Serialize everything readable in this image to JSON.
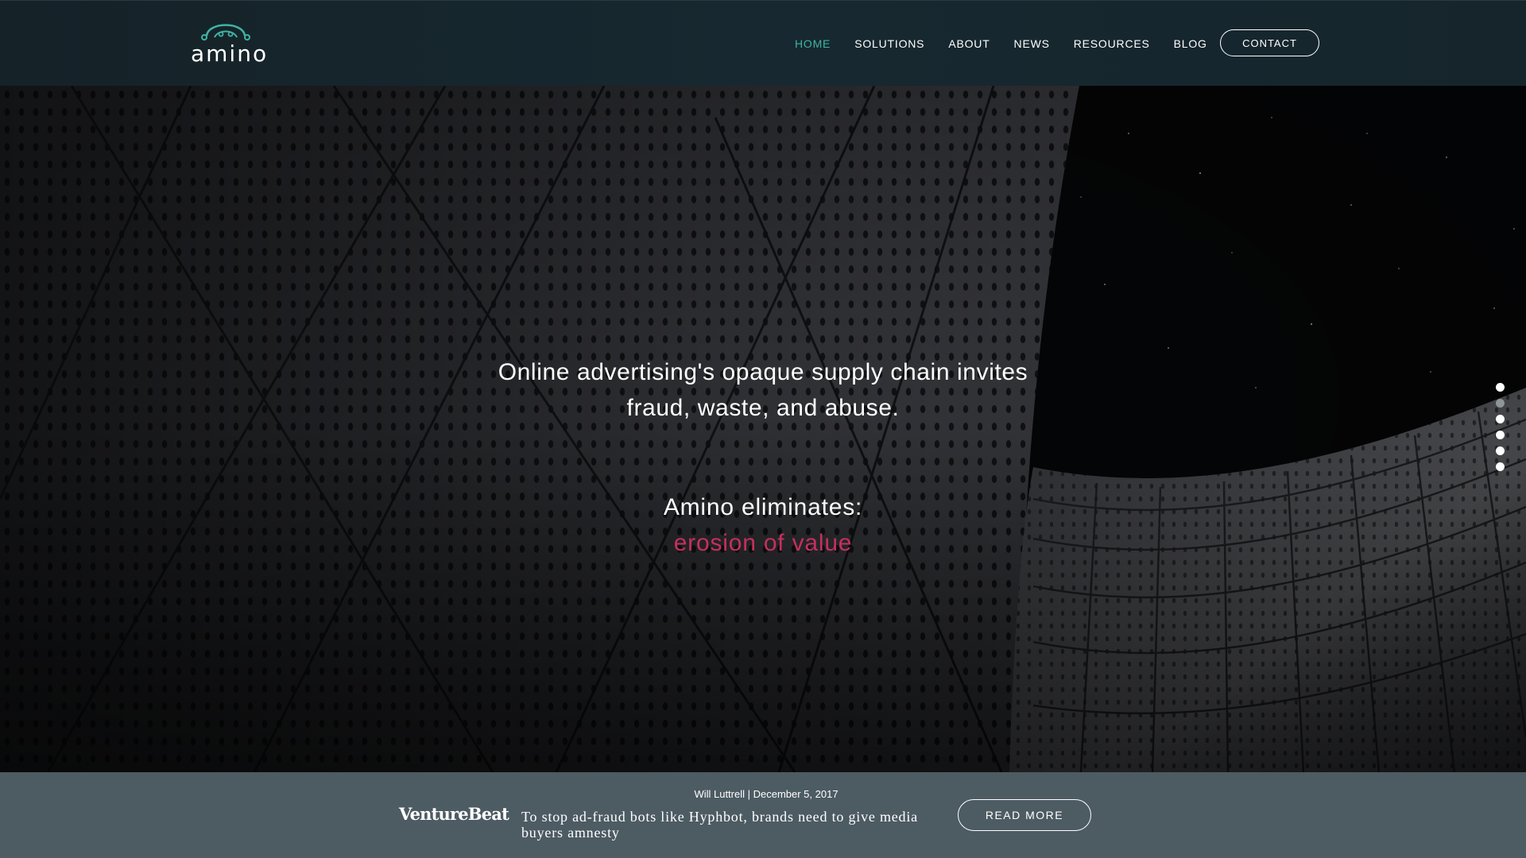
{
  "brand": {
    "logo_text": "amino",
    "accent_color": "#3fb3a4",
    "highlight_color": "#c4305d"
  },
  "nav": {
    "items": [
      {
        "label": "HOME",
        "active": true
      },
      {
        "label": "SOLUTIONS",
        "active": false
      },
      {
        "label": "ABOUT",
        "active": false
      },
      {
        "label": "NEWS",
        "active": false
      },
      {
        "label": "RESOURCES",
        "active": false
      },
      {
        "label": "BLOG",
        "active": false
      }
    ],
    "contact_label": "CONTACT"
  },
  "hero": {
    "headline_line1": "Online advertising's opaque supply chain invites",
    "headline_line2": "fraud, waste, and abuse.",
    "eliminates_label": "Amino eliminates:",
    "eliminates_word": "erosion of value",
    "slide_dots": {
      "count": 6,
      "active_index": 1
    }
  },
  "news": {
    "meta": "Will Luttrell | December 5, 2017",
    "source": "VentureBeat",
    "title": "To stop ad-fraud bots like Hyphbot, brands need to give media buyers amnesty",
    "read_more_label": "READ MORE"
  }
}
